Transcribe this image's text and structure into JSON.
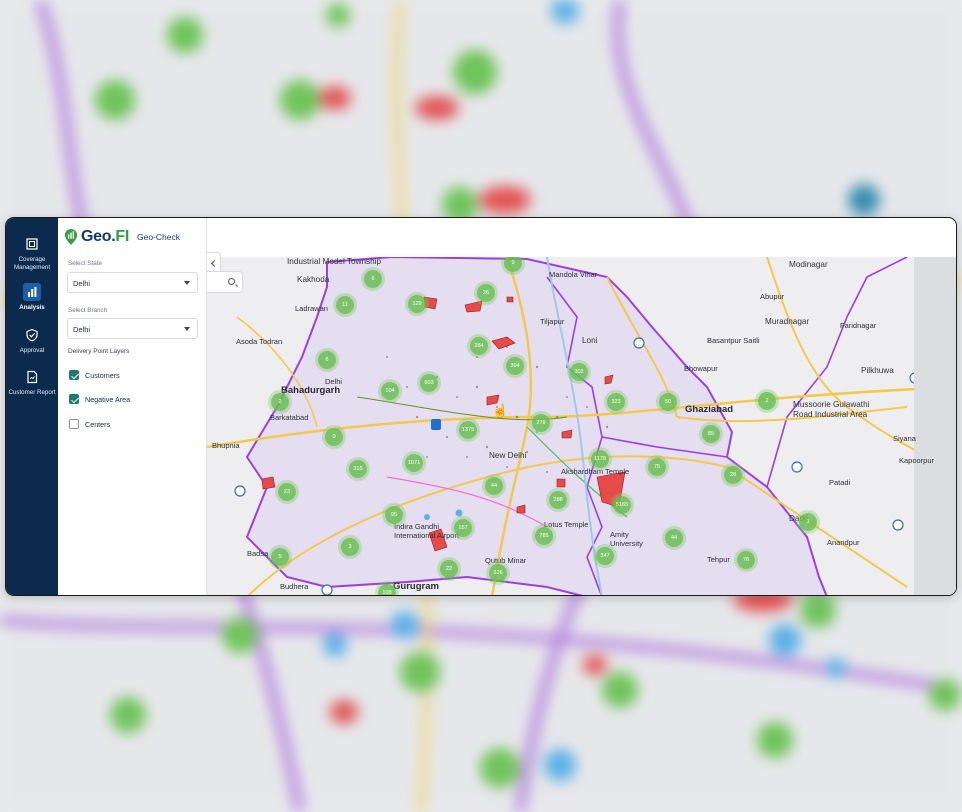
{
  "nav": {
    "items": [
      {
        "label": "Coverage Management",
        "icon": "coverage-icon",
        "active": false
      },
      {
        "label": "Analysis",
        "icon": "bar-chart-icon",
        "active": true
      },
      {
        "label": "Approval",
        "icon": "shield-check-icon",
        "active": false
      },
      {
        "label": "Customer Report",
        "icon": "report-icon",
        "active": false
      }
    ]
  },
  "brand": {
    "name_main": "Geo.",
    "name_accent": "FI",
    "product": "Geo-Check"
  },
  "filters": {
    "state_label": "Select State",
    "state_value": "Delhi",
    "branch_label": "Select Branch",
    "branch_value": "Delhi",
    "layers_label": "Delivery Point Layers",
    "layers": [
      {
        "label": "Customers",
        "checked": true
      },
      {
        "label": "Negative Area",
        "checked": true
      },
      {
        "label": "Centers",
        "checked": false
      }
    ]
  },
  "map": {
    "labels": [
      {
        "text": "Industrial Model Township",
        "cls": "med"
      },
      {
        "text": "Kakhoda",
        "cls": "med"
      },
      {
        "text": "Mandola Vihar",
        "cls": ""
      },
      {
        "text": "Modinagar",
        "cls": "med"
      },
      {
        "text": "Ladrawan",
        "cls": ""
      },
      {
        "text": "Tiljapur",
        "cls": ""
      },
      {
        "text": "Loni",
        "cls": "med"
      },
      {
        "text": "Abupur",
        "cls": ""
      },
      {
        "text": "Muradnagar",
        "cls": "med"
      },
      {
        "text": "Faridnagar",
        "cls": ""
      },
      {
        "text": "Asoda Todran",
        "cls": ""
      },
      {
        "text": "Basantpur Saitli",
        "cls": ""
      },
      {
        "text": "Pilkhuwa",
        "cls": "med"
      },
      {
        "text": "Bahadurgarh",
        "cls": "big"
      },
      {
        "text": "Delhi",
        "cls": ""
      },
      {
        "text": "Bhowapur",
        "cls": ""
      },
      {
        "text": "Ghaziabad",
        "cls": "big"
      },
      {
        "text": "Mussoorie Gulawathi Road Industrial Area",
        "cls": "med"
      },
      {
        "text": "Barkatabad",
        "cls": ""
      },
      {
        "text": "Bhupnia",
        "cls": ""
      },
      {
        "text": "New Delhi",
        "cls": "med"
      },
      {
        "text": "Akshardham Temple",
        "cls": ""
      },
      {
        "text": "Siyana",
        "cls": ""
      },
      {
        "text": "Kapoorpur",
        "cls": ""
      },
      {
        "text": "Patadi",
        "cls": ""
      },
      {
        "text": "Dadri",
        "cls": "med"
      },
      {
        "text": "Indira Gandhi International Airport",
        "cls": ""
      },
      {
        "text": "Lotus Temple",
        "cls": ""
      },
      {
        "text": "Amity University",
        "cls": ""
      },
      {
        "text": "Anandpur",
        "cls": ""
      },
      {
        "text": "Badsa",
        "cls": ""
      },
      {
        "text": "Qutub Minar",
        "cls": ""
      },
      {
        "text": "Budhera",
        "cls": ""
      },
      {
        "text": "Gurugram",
        "cls": "big"
      },
      {
        "text": "Tehpur",
        "cls": ""
      }
    ],
    "clusters": [
      "9",
      "6",
      "129",
      "26",
      "11",
      "6",
      "284",
      "364",
      "302",
      "603",
      "104",
      "2",
      "323",
      "50",
      "2",
      "9",
      "1375",
      "279",
      "85",
      "315",
      "1071",
      "44",
      "1178",
      "75",
      "28",
      "23",
      "288",
      "95",
      "5165",
      "157",
      "785",
      "44",
      "3",
      "347",
      "78",
      "5",
      "22",
      "326",
      "108",
      "1"
    ]
  },
  "colors": {
    "nav_bg": "#0b2a4d",
    "cluster": "#68be50",
    "negative_area": "#e84a4a",
    "boundary": "#9b3fe0",
    "road": "#f2c94c"
  }
}
